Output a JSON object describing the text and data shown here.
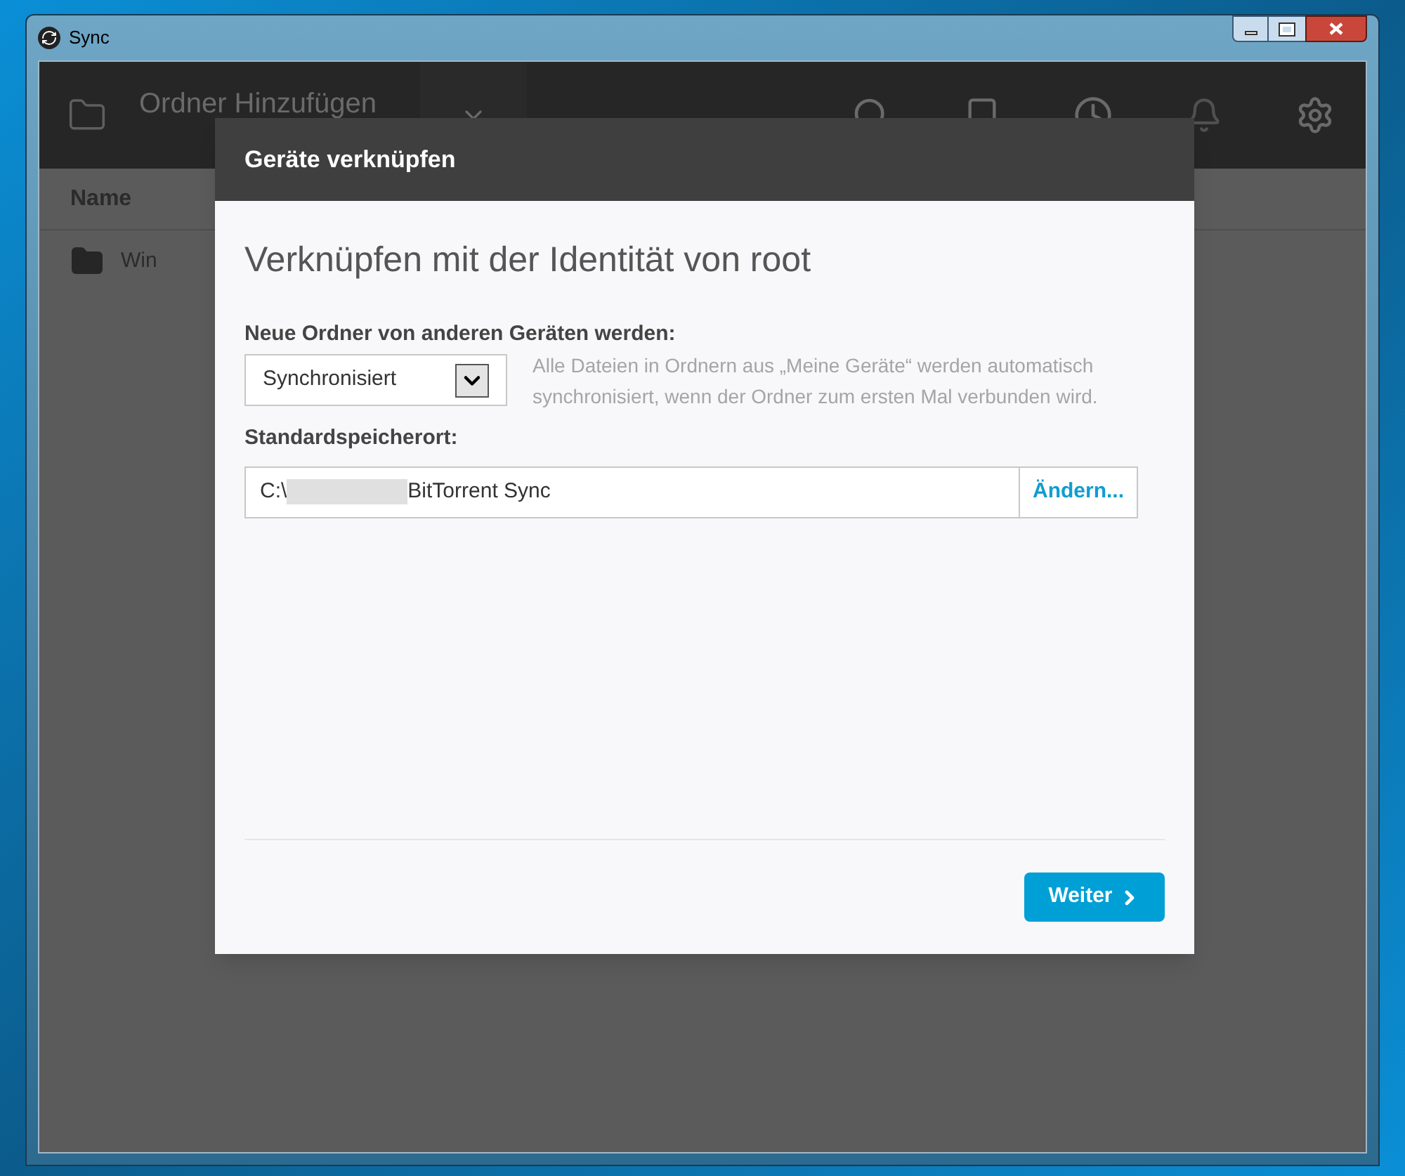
{
  "window": {
    "title": "Sync"
  },
  "toolbar": {
    "add_folder": "Ordner Hinzufügen"
  },
  "table": {
    "columns": [
      "Name"
    ],
    "rows": [
      {
        "name": "Win"
      }
    ]
  },
  "dialog": {
    "title": "Geräte verknüpfen",
    "heading": "Verknüpfen mit der Identität von root",
    "new_folders": {
      "label": "Neue Ordner von anderen Geräten werden:",
      "value": "Synchronisiert",
      "hint": "Alle Dateien in Ordnern aus „Meine Geräte“ werden automatisch synchronisiert, wenn der Ordner zum ersten Mal verbunden wird."
    },
    "location": {
      "label": "Standardspeicherort:",
      "value_start": "C:\\",
      "value_end": "BitTorrent Sync",
      "button": "Ändern..."
    },
    "next_button": "Weiter"
  }
}
